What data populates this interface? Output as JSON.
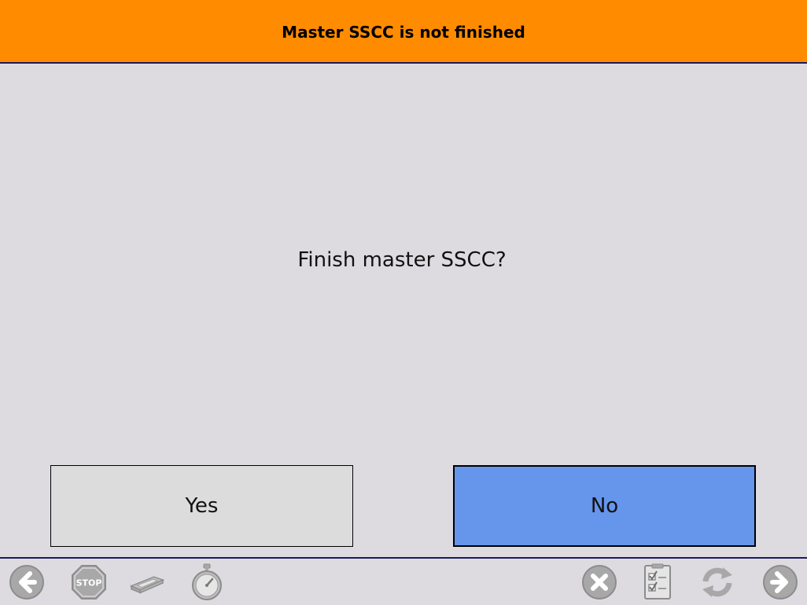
{
  "header": {
    "title": "Master SSCC is not finished"
  },
  "dialog": {
    "question": "Finish master SSCC?",
    "yes_label": "Yes",
    "no_label": "No"
  },
  "toolbar": {
    "stop_label": "STOP",
    "left_icons": [
      "back-arrow-icon",
      "stop-sign-icon",
      "scanner-icon",
      "stopwatch-icon"
    ],
    "right_icons": [
      "cancel-icon",
      "checklist-icon",
      "refresh-icon",
      "forward-arrow-icon"
    ]
  },
  "colors": {
    "header_bg": "#ff8c00",
    "background": "#dddbe0",
    "yes_bg": "#dcdcdc",
    "no_bg": "#6695ec",
    "divider": "#1a1a5e",
    "icon_gray": "#a8a8a8"
  }
}
